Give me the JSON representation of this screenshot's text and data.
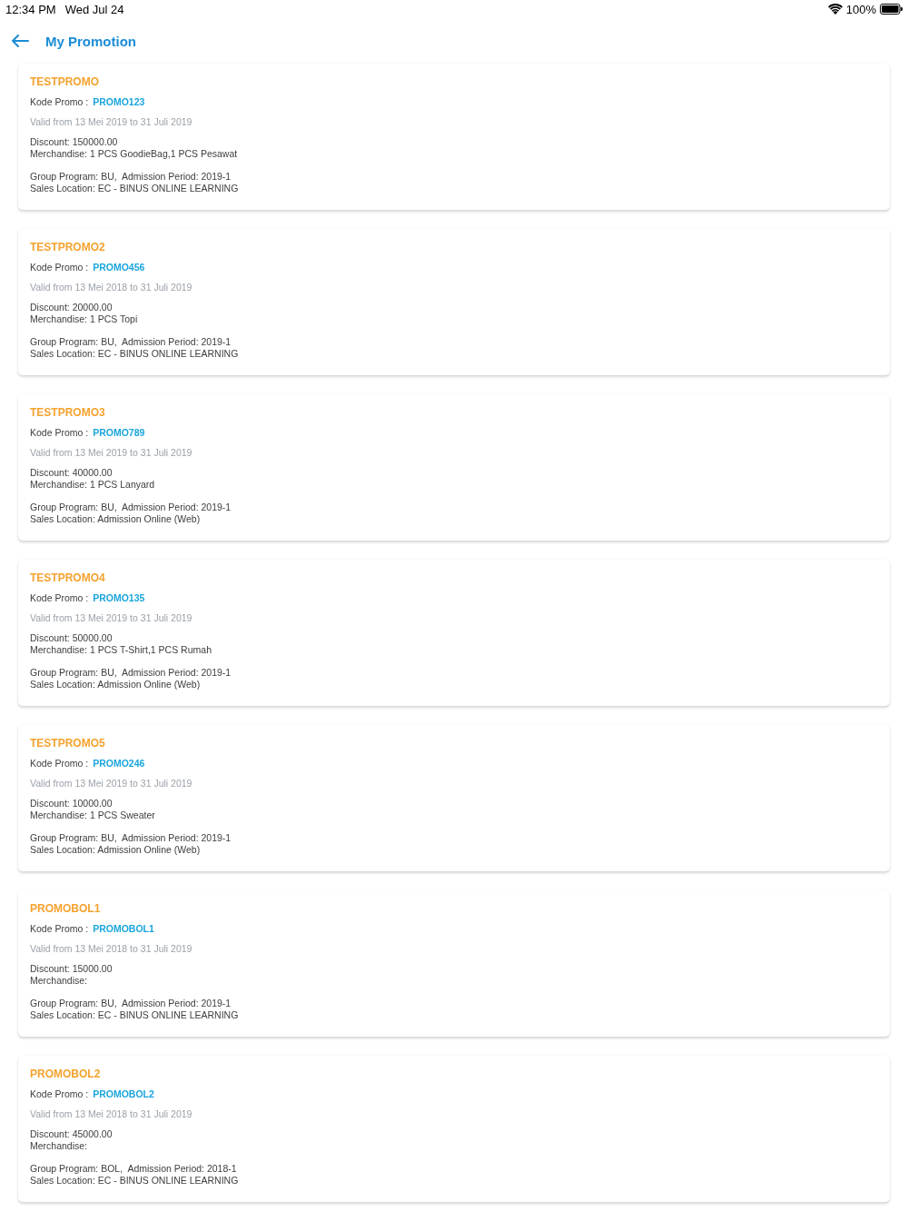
{
  "status_bar": {
    "time": "12:34 PM",
    "date": "Wed Jul 24",
    "battery": "100%"
  },
  "header": {
    "title": "My Promotion"
  },
  "promotions": [
    {
      "name": "TESTPROMO",
      "code_label": "Kode Promo :",
      "code": "PROMO123",
      "validity": "Valid from 13 Mei 2019 to 31 Juli 2019",
      "discount": "Discount: 150000.00",
      "merchandise": "Merchandise: 1 PCS GoodieBag,1 PCS Pesawat",
      "program": "Group Program: BU,  Admission Period: 2019-1",
      "location": "Sales Location: EC - BINUS ONLINE LEARNING"
    },
    {
      "name": "TESTPROMO2",
      "code_label": "Kode Promo :",
      "code": "PROMO456",
      "validity": "Valid from 13 Mei 2018 to 31 Juli 2019",
      "discount": "Discount: 20000.00",
      "merchandise": "Merchandise: 1 PCS Topi",
      "program": "Group Program: BU,  Admission Period: 2019-1",
      "location": "Sales Location: EC - BINUS ONLINE LEARNING"
    },
    {
      "name": "TESTPROMO3",
      "code_label": "Kode Promo :",
      "code": "PROMO789",
      "validity": "Valid from 13 Mei 2019 to 31 Juli 2019",
      "discount": "Discount: 40000.00",
      "merchandise": "Merchandise: 1 PCS Lanyard",
      "program": "Group Program: BU,  Admission Period: 2019-1",
      "location": "Sales Location: Admission Online (Web)"
    },
    {
      "name": "TESTPROMO4",
      "code_label": "Kode Promo :",
      "code": "PROMO135",
      "validity": "Valid from 13 Mei 2019 to 31 Juli 2019",
      "discount": "Discount: 50000.00",
      "merchandise": "Merchandise: 1 PCS T-Shirt,1 PCS Rumah",
      "program": "Group Program: BU,  Admission Period: 2019-1",
      "location": "Sales Location: Admission Online (Web)"
    },
    {
      "name": "TESTPROMO5",
      "code_label": "Kode Promo :",
      "code": "PROMO246",
      "validity": "Valid from 13 Mei 2019 to 31 Juli 2019",
      "discount": "Discount: 10000.00",
      "merchandise": "Merchandise: 1 PCS Sweater",
      "program": "Group Program: BU,  Admission Period: 2019-1",
      "location": "Sales Location: Admission Online (Web)"
    },
    {
      "name": "PROMOBOL1",
      "code_label": "Kode Promo :",
      "code": "PROMOBOL1",
      "validity": "Valid from 13 Mei 2018 to 31 Juli 2019",
      "discount": "Discount: 15000.00",
      "merchandise": "Merchandise:",
      "program": "Group Program: BU,  Admission Period: 2019-1",
      "location": "Sales Location: EC - BINUS ONLINE LEARNING"
    },
    {
      "name": "PROMOBOL2",
      "code_label": "Kode Promo :",
      "code": "PROMOBOL2",
      "validity": "Valid from 13 Mei 2018 to 31 Juli 2019",
      "discount": "Discount: 45000.00",
      "merchandise": "Merchandise:",
      "program": "Group Program: BOL,  Admission Period: 2018-1",
      "location": "Sales Location: EC - BINUS ONLINE LEARNING"
    }
  ]
}
